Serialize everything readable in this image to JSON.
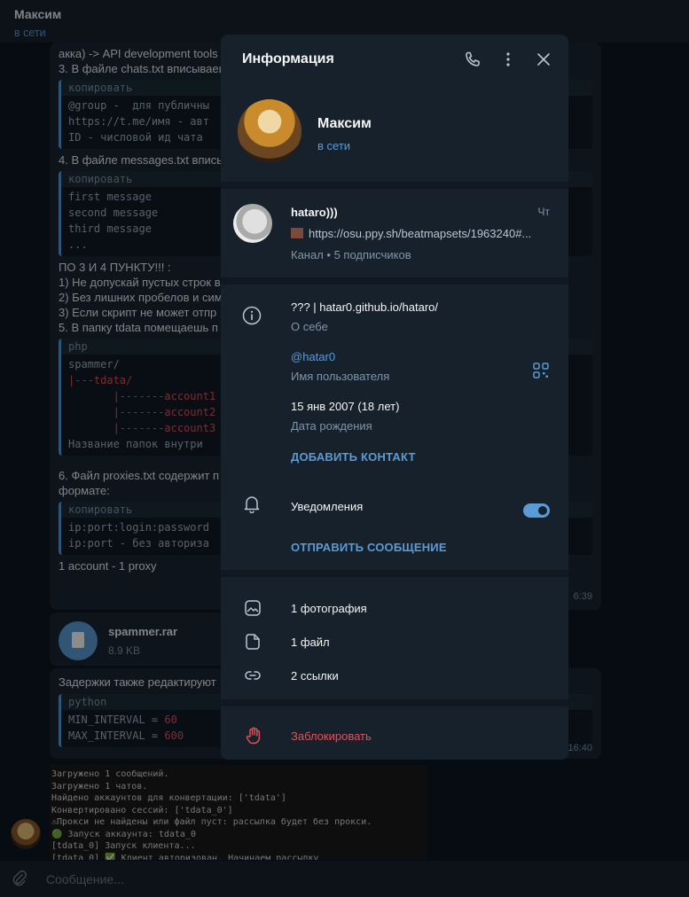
{
  "chat_header": {
    "name": "Максим",
    "status": "в сети"
  },
  "message": {
    "lines_before": [
      "акка) -> API development tools",
      "3. В файле chats.txt вписываеш"
    ],
    "code1": {
      "lang": "копировать",
      "lines": [
        "@group -  для публичны",
        "https://t.me/имя - авт",
        "ID - числовой ид чата "
      ]
    },
    "line2": "4. В файле messages.txt впись",
    "code2": {
      "lang": "копировать",
      "lines": [
        "first message",
        "second message",
        "third message",
        "..."
      ]
    },
    "lines_mid": [
      "ПО 3 И 4 ПУНКТУ!!! :",
      "1) Не допускай пустых строк в",
      "2) Без лишних пробелов и сим",
      "3) Если скрипт не может отпр",
      "5. В папку tdata помещаешь п"
    ],
    "code3": {
      "lang": "php",
      "lines": [
        "spammer/",
        "|---tdata/",
        "       |-------account1",
        "       |-------account2",
        "       |-------account3",
        "",
        "Название папок внутри "
      ]
    },
    "lines_after": [
      "6. Файл proxies.txt содержит п",
      "формате:"
    ],
    "code4": {
      "lang": "копировать",
      "lines": [
        "ip:port:login:password",
        "ip:port - без авториза"
      ]
    },
    "last_line": "1 account - 1 proxy",
    "time": "6:39"
  },
  "file": {
    "name": "spammer.rar",
    "size": "8.9 KB"
  },
  "message2": {
    "text": "Задержки также редактируют",
    "code": {
      "lang": "python",
      "lines": [
        [
          "MIN_INTERVAL = ",
          "60"
        ],
        [
          "MAX_INTERVAL = ",
          "600"
        ]
      ]
    },
    "time": "16:40"
  },
  "console_lines": [
    "Загружено 1 сообщений.",
    "Загружено 1 чатов.",
    "Найдено аккаунтов для конвертации: ['tdata']",
    "Конвертировано сессий: ['tdata_0']",
    "⚠Прокси не найдены или файл пуст: рассылка будет без прокси.",
    "🟢 Запуск аккаунта: tdata_0",
    "[tdata_0] Запуск клиента...",
    "[tdata_0] ✅ Клиент авторизован. Начинаем рассылку"
  ],
  "compose": {
    "placeholder": "Сообщение..."
  },
  "modal": {
    "title": "Информация",
    "profile": {
      "name": "Максим",
      "status": "в сети"
    },
    "channel": {
      "name": "hataro)))",
      "day": "Чт",
      "link": "https://osu.ppy.sh/beatmapsets/1963240#...",
      "meta": "Канал • 5 подписчиков"
    },
    "bio": {
      "text": "??? | hatar0.github.io/hataro/",
      "label": "О себе"
    },
    "username": {
      "text": "@hatar0",
      "label": "Имя пользователя"
    },
    "birthday": {
      "text": "15 янв 2007 (18 лет)",
      "label": "Дата рождения"
    },
    "add_contact": "ДОБАВИТЬ КОНТАКТ",
    "notifications": {
      "label": "Уведомления",
      "enabled": true
    },
    "send_message": "ОТПРАВИТЬ СООБЩЕНИЕ",
    "media": {
      "photos": "1 фотография",
      "files": "1 файл",
      "links": "2 ссылки"
    },
    "block": "Заблокировать"
  },
  "colors": {
    "accent": "#5a9bd6",
    "danger": "#e0535b",
    "panel": "#17212b",
    "background": "#0e1621"
  }
}
